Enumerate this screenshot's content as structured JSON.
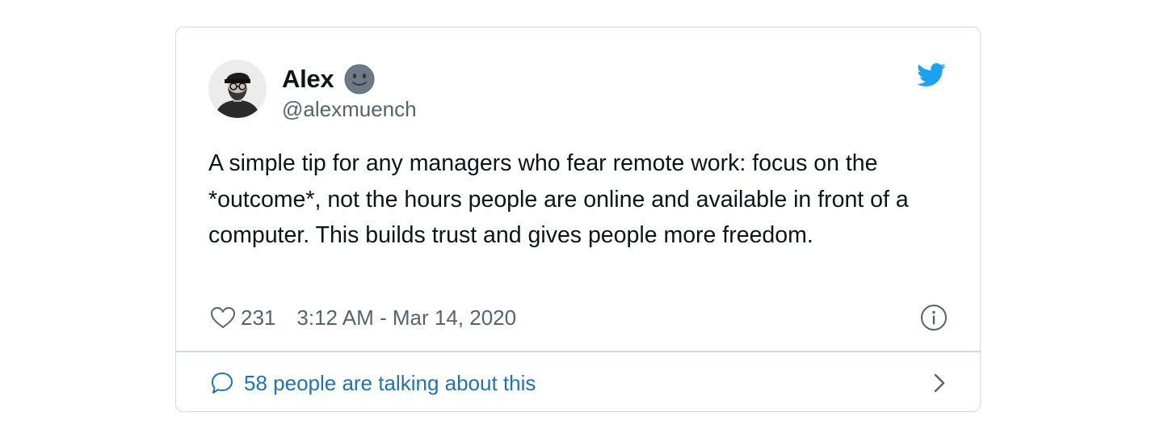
{
  "tweet": {
    "author": {
      "display_name": "Alex",
      "handle": "@alexmuench",
      "avatar": "profile-photo",
      "name_emoji": "slightly-smiling-face-icon"
    },
    "text": "A simple tip for any managers who fear remote work: focus on the *outcome*, not the hours people are online and available in front of a computer. This builds trust and gives people more freedom.",
    "likes": "231",
    "timestamp": "3:12 AM - Mar 14, 2020",
    "conversation_label": "58 people are talking about this"
  },
  "icons": {
    "brand": "twitter-bird-icon",
    "like": "heart-icon",
    "info": "info-icon",
    "reply": "speech-bubble-icon",
    "open": "chevron-right-icon"
  },
  "colors": {
    "twitter_blue": "#1da1f2",
    "link_blue": "#1d73b7",
    "secondary_text": "#536471",
    "primary_text": "#0f1419",
    "border": "#cfd9de"
  }
}
